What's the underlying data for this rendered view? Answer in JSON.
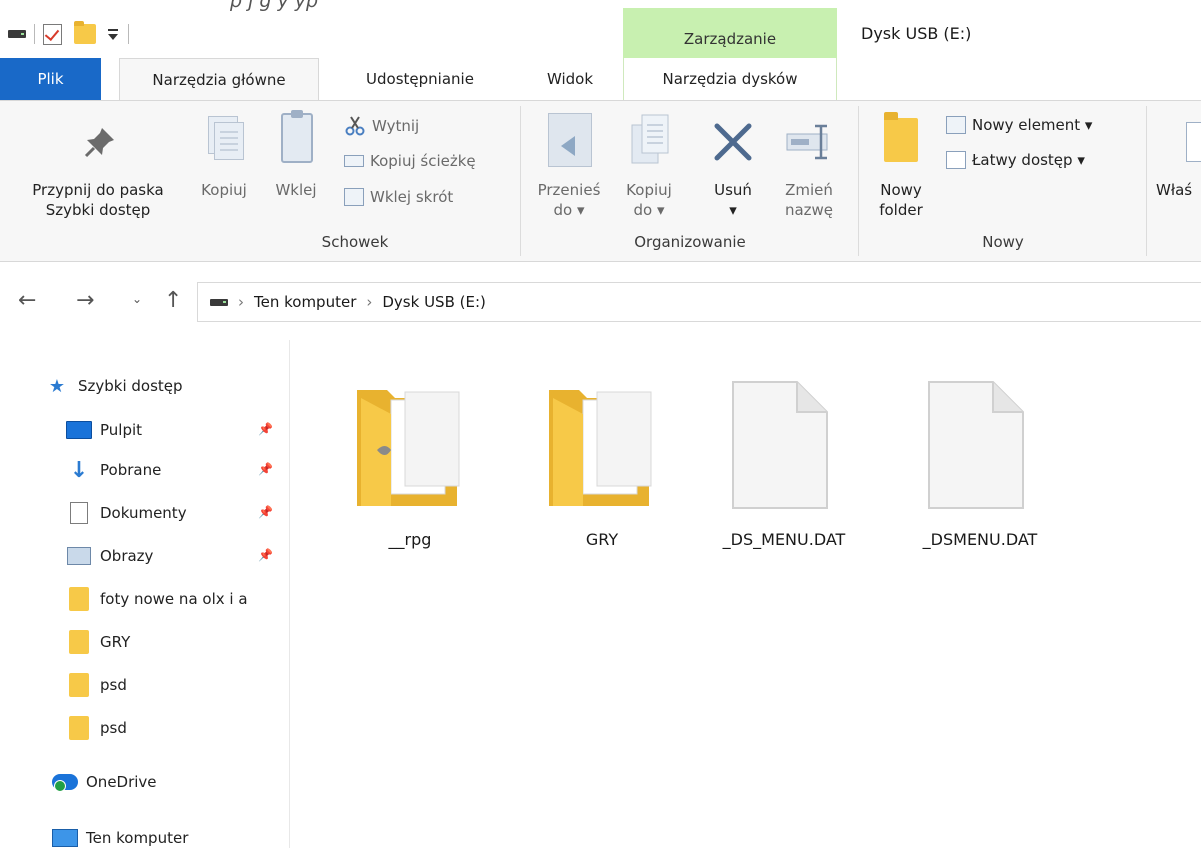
{
  "top_clip_text": "p                 j  g                     y        yp",
  "qat": {
    "icons": [
      "drive-icon",
      "properties-icon",
      "new-folder-icon",
      "customize-qat-icon"
    ]
  },
  "window": {
    "context_group": "Zarządzanie",
    "title": "Dysk USB (E:)"
  },
  "tabs": {
    "file": "Plik",
    "home": "Narzędzia główne",
    "share": "Udostępnianie",
    "view": "Widok",
    "disk_tools": "Narzędzia dysków"
  },
  "ribbon": {
    "pin_line1": "Przypnij do paska",
    "pin_line2": "Szybki dostęp",
    "copy": "Kopiuj",
    "paste": "Wklej",
    "cut": "Wytnij",
    "copy_path": "Kopiuj ścieżkę",
    "paste_shortcut": "Wklej skrót",
    "group_clipboard": "Schowek",
    "move_to_line1": "Przenieś",
    "move_to_line2": "do ▾",
    "copy_to_line1": "Kopiuj",
    "copy_to_line2": "do ▾",
    "delete_line1": "Usuń",
    "delete_line2": "▾",
    "rename_line1": "Zmień",
    "rename_line2": "nazwę",
    "group_organize": "Organizowanie",
    "new_folder_line1": "Nowy",
    "new_folder_line2": "folder",
    "new_item": "Nowy element ▾",
    "easy_access": "Łatwy dostęp ▾",
    "group_new": "Nowy",
    "properties_clip": "Właś"
  },
  "address": {
    "crumb1": "Ten komputer",
    "crumb2": "Dysk USB (E:)"
  },
  "tree": [
    {
      "label": "Szybki dostęp",
      "icon": "star-icon"
    },
    {
      "label": "Pulpit",
      "icon": "desktop-icon",
      "pinned": true
    },
    {
      "label": "Pobrane",
      "icon": "download-icon",
      "pinned": true
    },
    {
      "label": "Dokumenty",
      "icon": "documents-icon",
      "pinned": true
    },
    {
      "label": "Obrazy",
      "icon": "pictures-icon",
      "pinned": true
    },
    {
      "label": "foty nowe na olx i a",
      "icon": "folder-icon"
    },
    {
      "label": "GRY",
      "icon": "folder-icon"
    },
    {
      "label": "psd",
      "icon": "folder-icon"
    },
    {
      "label": "psd",
      "icon": "folder-icon"
    },
    {
      "label": "OneDrive",
      "icon": "onedrive-icon"
    },
    {
      "label": "Ten komputer",
      "icon": "computer-icon"
    }
  ],
  "files": [
    {
      "name": "__rpg",
      "type": "folder"
    },
    {
      "name": "GRY",
      "type": "folder"
    },
    {
      "name": "_DS_MENU.DAT",
      "type": "file"
    },
    {
      "name": "_DSMENU.DAT",
      "type": "file"
    }
  ],
  "colors": {
    "file_tab": "#1969c8",
    "context_tab": "#c8f0b0",
    "folder": "#f7c948",
    "accent": "#2b7bd1"
  }
}
